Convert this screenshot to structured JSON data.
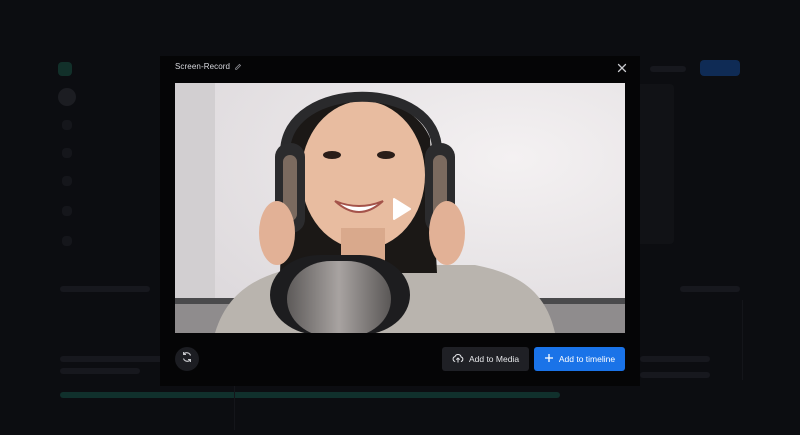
{
  "dialog": {
    "title": "Screen-Record"
  },
  "actions": {
    "add_to_media": "Add to Media",
    "add_to_timeline": "Add to timeline"
  },
  "icons": {
    "edit": "pencil-icon",
    "close": "close-icon",
    "play": "play-icon",
    "rotate": "refresh-icon",
    "upload": "cloud-upload-icon",
    "plus": "plus-icon"
  },
  "colors": {
    "accent": "#1a73e8",
    "secondary_button": "#1f2025",
    "modal_bg": "#050506"
  }
}
